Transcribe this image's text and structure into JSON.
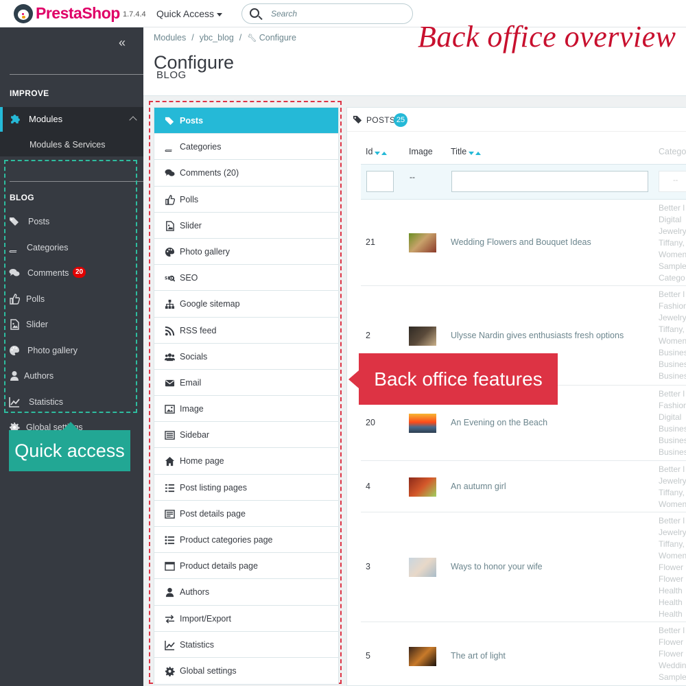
{
  "header": {
    "brand": "PrestaShop",
    "version": "1.7.4.4",
    "quick_access": "Quick Access",
    "search_placeholder": "Search"
  },
  "sidebar": {
    "improve_heading": "IMPROVE",
    "modules_label": "Modules",
    "modules_services_label": "Modules & Services",
    "blog_heading": "BLOG",
    "items": [
      {
        "label": "Posts",
        "icon": "tags-icon"
      },
      {
        "label": "Categories",
        "icon": "book-icon"
      },
      {
        "label": "Comments",
        "icon": "comments-icon",
        "badge": "20"
      },
      {
        "label": "Polls",
        "icon": "thumbs-up-icon"
      },
      {
        "label": "Slider",
        "icon": "image-file-icon"
      },
      {
        "label": "Photo gallery",
        "icon": "palette-icon"
      },
      {
        "label": "Authors",
        "icon": "user-icon"
      },
      {
        "label": "Statistics",
        "icon": "line-chart-icon"
      },
      {
        "label": "Global settings",
        "icon": "gear-icon"
      }
    ]
  },
  "breadcrumb": {
    "items": [
      "Modules",
      "ybc_blog",
      "Configure"
    ]
  },
  "page": {
    "title": "Configure",
    "subtitle": "BLOG"
  },
  "annotations": {
    "hero": "Back office overview",
    "features_callout": "Back office features",
    "quick_access_callout": "Quick access"
  },
  "feature_menu": [
    {
      "label": "Posts",
      "icon": "tags-icon",
      "active": true
    },
    {
      "label": "Categories",
      "icon": "book-icon"
    },
    {
      "label": "Comments (20)",
      "icon": "comments-icon"
    },
    {
      "label": "Polls",
      "icon": "thumbs-up-icon"
    },
    {
      "label": "Slider",
      "icon": "image-file-icon"
    },
    {
      "label": "Photo gallery",
      "icon": "palette-icon"
    },
    {
      "label": "SEO",
      "icon": "seo-icon"
    },
    {
      "label": "Google sitemap",
      "icon": "sitemap-icon"
    },
    {
      "label": "RSS feed",
      "icon": "rss-icon"
    },
    {
      "label": "Socials",
      "icon": "users-icon"
    },
    {
      "label": "Email",
      "icon": "envelope-icon"
    },
    {
      "label": "Image",
      "icon": "picture-icon"
    },
    {
      "label": "Sidebar",
      "icon": "sidebar-icon"
    },
    {
      "label": "Home page",
      "icon": "home-icon"
    },
    {
      "label": "Post listing pages",
      "icon": "list-icon"
    },
    {
      "label": "Post details page",
      "icon": "details-icon"
    },
    {
      "label": "Product categories page",
      "icon": "list-ul-icon"
    },
    {
      "label": "Product details page",
      "icon": "window-icon"
    },
    {
      "label": "Authors",
      "icon": "user-icon"
    },
    {
      "label": "Import/Export",
      "icon": "exchange-icon"
    },
    {
      "label": "Statistics",
      "icon": "line-chart-icon"
    },
    {
      "label": "Global settings",
      "icon": "gear-icon"
    }
  ],
  "posts_panel": {
    "title": "POSTS",
    "count": "25",
    "columns": [
      "Id",
      "Image",
      "Title",
      "Catego"
    ],
    "filter_image_placeholder": "--",
    "filter_category_placeholder": "--",
    "rows": [
      {
        "id": "21",
        "title": "Wedding Flowers and Bouquet Ideas",
        "categories": [
          "Better l",
          "Digital",
          "Jewelry",
          "Tiffany,",
          "Women",
          "Sample",
          "Catego"
        ]
      },
      {
        "id": "2",
        "title": "Ulysse Nardin gives enthusiasts fresh options",
        "categories": [
          "Better l",
          "Fashion",
          "Jewelry",
          "Tiffany,",
          "Women",
          "Busines",
          "Busines",
          "Busines"
        ]
      },
      {
        "id": "20",
        "title": "An Evening on the Beach",
        "categories": [
          "Better l",
          "Fashion",
          "Digital",
          "Busines",
          "Busines",
          "Busines"
        ]
      },
      {
        "id": "4",
        "title": "An autumn girl",
        "categories": [
          "Better l",
          "Jewelry",
          "Tiffany,",
          "Women"
        ]
      },
      {
        "id": "3",
        "title": "Ways to honor your wife",
        "categories": [
          "Better l",
          "Jewelry",
          "Tiffany,",
          "Women",
          "Flower",
          "Flower",
          "Health",
          "Health",
          "Health"
        ]
      },
      {
        "id": "5",
        "title": "The art of light",
        "categories": [
          "Better l",
          "Flower",
          "Flower",
          "Weddin",
          "Sample"
        ]
      }
    ]
  },
  "colors": {
    "brand_pink": "#df0067",
    "accent_blue": "#25b9d7",
    "sidebar_dark": "#363a41",
    "teal_annotation": "#22a794",
    "red_annotation": "#dd3344"
  }
}
